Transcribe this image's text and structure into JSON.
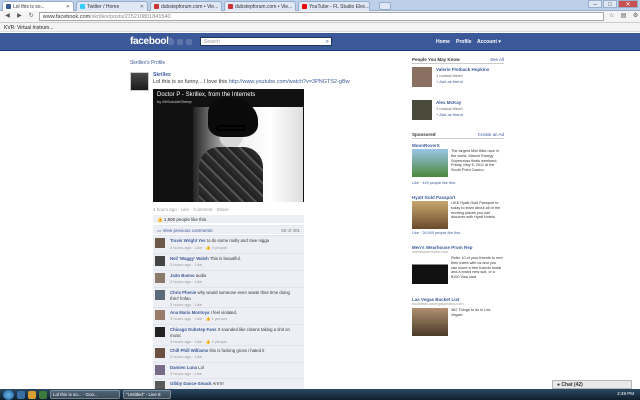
{
  "browser": {
    "tabs": [
      {
        "title": "Lol this is so..."
      },
      {
        "title": "Twitter / Home"
      },
      {
        "title": "dubstepforum.com • Vie..."
      },
      {
        "title": "dubstepforum.com • Vie..."
      },
      {
        "title": "YouTube - FL Studio Elec..."
      }
    ],
    "url_host": "www.facebook.com",
    "url_path": "/skrillex/posts/215210801841540",
    "bookmark": "KVR: Virtual Instrum..."
  },
  "fb": {
    "logo": "facebook",
    "search_placeholder": "Search",
    "nav": {
      "home": "Home",
      "profile": "Profile",
      "account": "Account ▾"
    }
  },
  "post": {
    "breadcrumb": "Skrillex's Profile",
    "author": "Skrillex",
    "text": "Lol this is so funny... I love this ",
    "link": "http://www.youtube.com/watch?v=3PNGTS2-gBw",
    "video_title": "Doctor P - Skrillex, from the Internets",
    "video_by": "by MrSuicideSheep",
    "meta": "4 hours ago · Like · Comment · Share",
    "likes": "1,900 people like this.",
    "prev_comments": "View previous comments",
    "comment_count": "50 of 301"
  },
  "comments": [
    {
      "name": "Travis Wright Yes",
      "text": "to do some molly and rave nigga",
      "time": "3 hours ago · Like · 👍 4 people"
    },
    {
      "name": "Neil 'Waggy' Walsh",
      "text": "This is beautiful.",
      "time": "3 hours ago · Like"
    },
    {
      "name": "João Bueno",
      "text": "audio",
      "time": "3 hours ago · Like"
    },
    {
      "name": "Chris Phenie",
      "text": "why would someone even waste their time doing this? lmfao",
      "time": "3 hours ago · Like"
    },
    {
      "name": "Ana Maria Montoya",
      "text": "I feel violated.",
      "time": "3 hours ago · Like · 👍 1 person"
    },
    {
      "name": "Chicago Dubstep Fans",
      "text": "It sounded like clowns taking a shit on music",
      "time": "3 hours ago · Like · 👍 2 people"
    },
    {
      "name": "Chill Phill Williams",
      "text": "this is fucking gross i hated it",
      "time": "3 hours ago · Like"
    },
    {
      "name": "Damien Luna",
      "text": "Lol",
      "time": "3 hours ago · Like"
    },
    {
      "name": "Gibby Dance-Smack",
      "text": "Arrrrrr",
      "time": "3 hours ago · Like"
    }
  ],
  "sidebar": {
    "pymk_title": "People You May Know",
    "see_all": "See All",
    "people": [
      {
        "name": "Valerie Flotback Hopkins",
        "mutual": "1 mutual friend",
        "add": "Add as friend"
      },
      {
        "name": "Alex McKay",
        "mutual": "1 mutual friend",
        "add": "Add as friend"
      }
    ],
    "sponsored_title": "Sponsored",
    "create_ad": "Create an Ad",
    "ads": [
      {
        "title": "MoonRoverX",
        "url": "",
        "body": "The largest Mini Bike race in the world. Manvrr Energy Supercross finals weekend, Friday, May 6, 2011 at the South Point Casino.",
        "likes": "Like · 449 people like this.",
        "color": "#4a8a3a"
      },
      {
        "title": "Hyatt Gold Passport",
        "url": "",
        "body": "LIKE Hyatt Gold Passport to today to learn about all of the exciting places you can discover with Hyatt Hotels.",
        "likes": "Like · 26,900 people like this.",
        "color": "#8b6b3d"
      },
      {
        "title": "Men's Wearhouse Prom Rep",
        "url": "menswearhouse.com",
        "body": "Refer 10 of your friends to rent their tuxes with us and you can score a free tuxedo rental and a brand new suit, or a $100 Visa card",
        "likes": "",
        "color": "#1a1a1a"
      },
      {
        "title": "Las Vegas Bucket List",
        "url": "bucketlist.lasvegasphotos.com",
        "body": "362 Things to do in Las Vegas!",
        "likes": "",
        "color": "#6a5a4a"
      }
    ]
  },
  "chat": "Chat (42)",
  "taskbar": {
    "apps": [
      "Lol this is so... · Goo...",
      "\"Untitled\" - Live 8"
    ],
    "clock": "2:49 PM"
  }
}
